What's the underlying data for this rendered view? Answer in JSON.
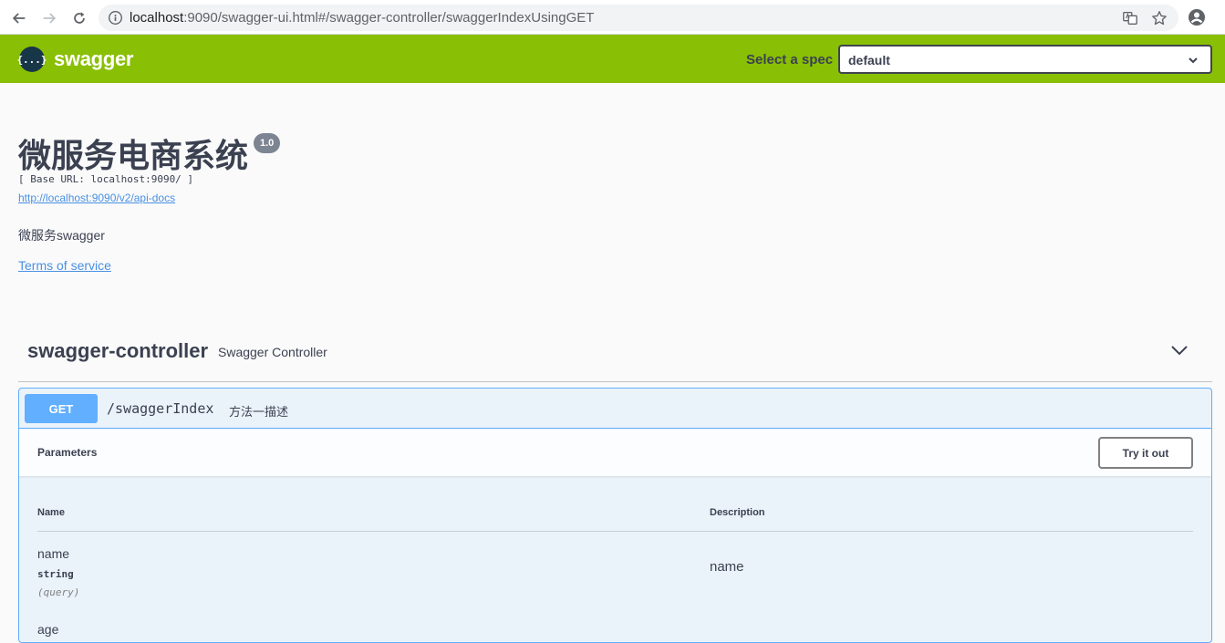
{
  "browser": {
    "url_host": "localhost",
    "url_rest": ":9090/swagger-ui.html#/swagger-controller/swaggerIndexUsingGET"
  },
  "topbar": {
    "logo_symbol": "{...}",
    "logo_text": "swagger",
    "spec_label": "Select a spec",
    "spec_value": "default",
    "bg_color": "#89bf04"
  },
  "info": {
    "title": "微服务电商系统",
    "version": "1.0",
    "base_url": "[ Base URL: localhost:9090/ ]",
    "api_docs_link": "http://localhost:9090/v2/api-docs",
    "description": "微服务swagger",
    "terms_link": "Terms of service"
  },
  "tag": {
    "name": "swagger-controller",
    "description": "Swagger Controller"
  },
  "operation": {
    "method": "GET",
    "method_color": "#61affe",
    "path": "/swaggerIndex",
    "summary": "方法一描述",
    "parameters_title": "Parameters",
    "try_button": "Try it out",
    "columns": {
      "name": "Name",
      "description": "Description"
    },
    "params": [
      {
        "name": "name",
        "type": "string",
        "in": "(query)",
        "description": "name"
      },
      {
        "name": "age"
      }
    ]
  }
}
